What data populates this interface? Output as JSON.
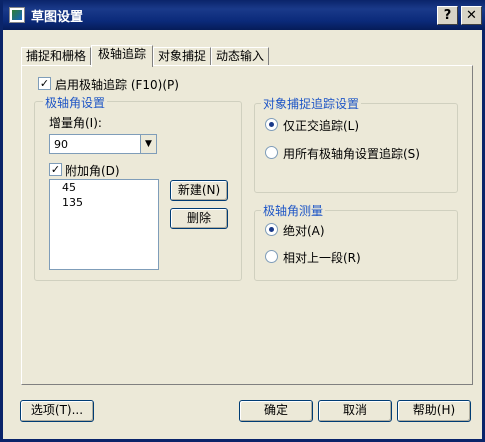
{
  "window": {
    "title": "草图设置",
    "help_button": "?",
    "close_button": "✕"
  },
  "tabs": [
    {
      "label": "捕捉和栅格",
      "active": false
    },
    {
      "label": "极轴追踪",
      "active": true
    },
    {
      "label": "对象捕捉",
      "active": false
    },
    {
      "label": "动态输入",
      "active": false
    }
  ],
  "polar": {
    "enable_label": "启用极轴追踪 (F10)(P)",
    "enable_checked": true,
    "angle_group_title": "极轴角设置",
    "increment_label": "增量角(I):",
    "increment_value": "90",
    "additional_label": "附加角(D)",
    "additional_checked": true,
    "additional_angles": [
      "45",
      "135"
    ],
    "new_button": "新建(N)",
    "delete_button": "删除"
  },
  "snap_tracking": {
    "group_title": "对象捕捉追踪设置",
    "options": [
      {
        "label": "仅正交追踪(L)",
        "selected": true
      },
      {
        "label": "用所有极轴角设置追踪(S)",
        "selected": false
      }
    ]
  },
  "measurement": {
    "group_title": "极轴角测量",
    "options": [
      {
        "label": "绝对(A)",
        "selected": true
      },
      {
        "label": "相对上一段(R)",
        "selected": false
      }
    ]
  },
  "footer": {
    "options_button": "选项(T)...",
    "ok_button": "确定",
    "cancel_button": "取消",
    "help_button": "帮助(H)"
  },
  "colors": {
    "titlebar": "#0a246a",
    "group_title": "#1d55c6",
    "dialog_bg": "#ece9d8"
  }
}
